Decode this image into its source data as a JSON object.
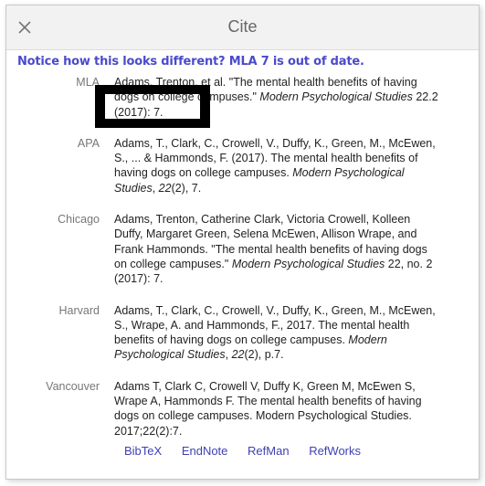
{
  "dialog": {
    "title": "Cite",
    "close_icon": "close-icon",
    "notice": "Notice how this looks different? MLA 7 is out of date."
  },
  "citations": [
    {
      "format": "MLA",
      "parts": [
        {
          "text": "Adams, Trenton, et al. \"The mental health benefits of having dogs on college campuses.\" ",
          "italic": false
        },
        {
          "text": "Modern Psychological Studies",
          "italic": true
        },
        {
          "text": " 22.2 (2017): 7.",
          "italic": false
        }
      ]
    },
    {
      "format": "APA",
      "parts": [
        {
          "text": "Adams, T., Clark, C., Crowell, V., Duffy, K., Green, M., McEwen, S., ... & Hammonds, F. (2017). The mental health benefits of having dogs on college campuses. ",
          "italic": false
        },
        {
          "text": "Modern Psychological Studies",
          "italic": true
        },
        {
          "text": ", ",
          "italic": false
        },
        {
          "text": "22",
          "italic": true
        },
        {
          "text": "(2), 7.",
          "italic": false
        }
      ]
    },
    {
      "format": "Chicago",
      "parts": [
        {
          "text": "Adams, Trenton, Catherine Clark, Victoria Crowell, Kolleen Duffy, Margaret Green, Selena McEwen, Allison Wrape, and Frank Hammonds. \"The mental health benefits of having dogs on college campuses.\" ",
          "italic": false
        },
        {
          "text": "Modern Psychological Studies",
          "italic": true
        },
        {
          "text": " 22, no. 2 (2017): 7.",
          "italic": false
        }
      ]
    },
    {
      "format": "Harvard",
      "parts": [
        {
          "text": "Adams, T., Clark, C., Crowell, V., Duffy, K., Green, M., McEwen, S., Wrape, A. and Hammonds, F., 2017. The mental health benefits of having dogs on college campuses. ",
          "italic": false
        },
        {
          "text": "Modern Psychological Studies",
          "italic": true
        },
        {
          "text": ", ",
          "italic": false
        },
        {
          "text": "22",
          "italic": true
        },
        {
          "text": "(2), p.7.",
          "italic": false
        }
      ]
    },
    {
      "format": "Vancouver",
      "parts": [
        {
          "text": "Adams T, Clark C, Crowell V, Duffy K, Green M, McEwen S, Wrape A, Hammonds F. The mental health benefits of having dogs on college campuses. Modern Psychological Studies. 2017;22(2):7.",
          "italic": false
        }
      ]
    }
  ],
  "export_links": [
    "BibTeX",
    "EndNote",
    "RefMan",
    "RefWorks"
  ],
  "colors": {
    "notice": "#4a4acc",
    "link": "#3f3fb5",
    "header_bg": "#f2f2f2",
    "annotation_box": "#000000"
  }
}
